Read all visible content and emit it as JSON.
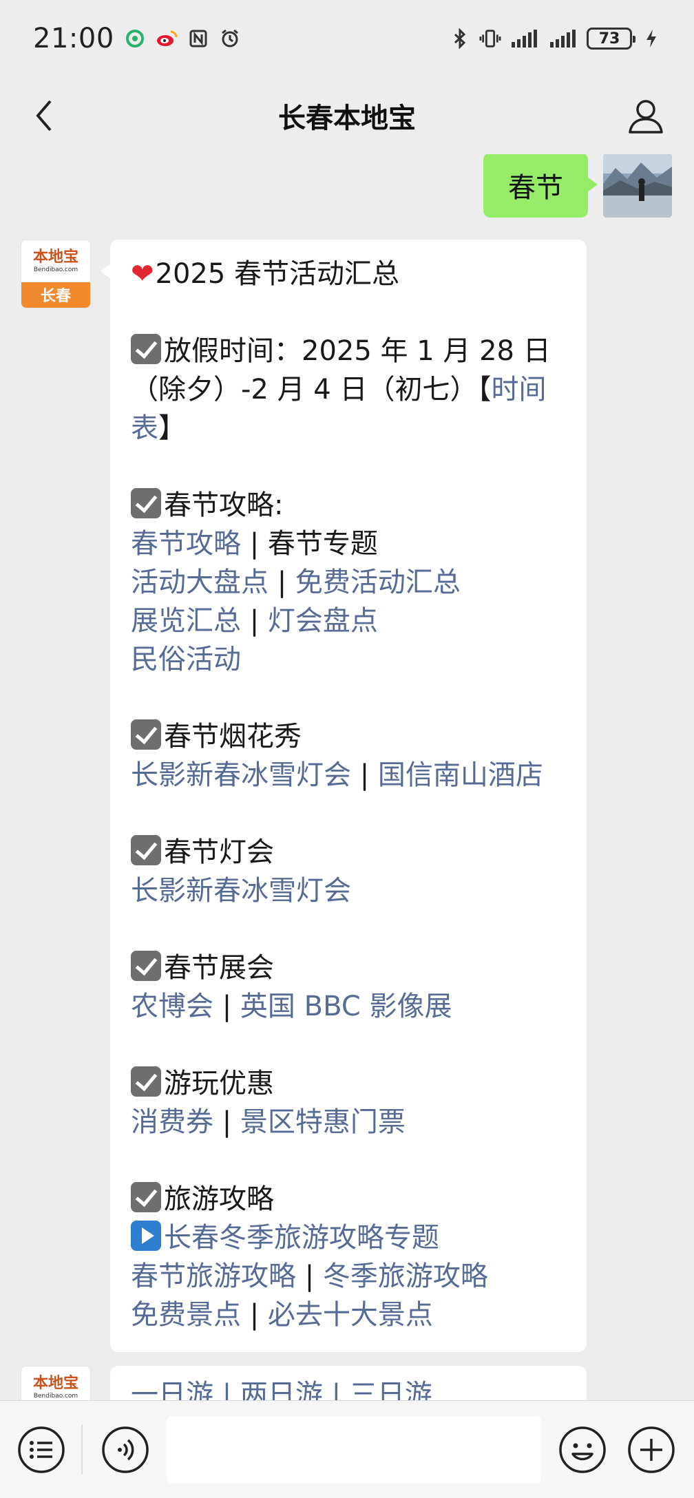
{
  "status_bar": {
    "time": "21:00",
    "battery": "73"
  },
  "nav": {
    "title": "长春本地宝"
  },
  "my_message": {
    "text": "春节"
  },
  "bot": {
    "avatar_brand": "本地宝",
    "avatar_sub": "Bendibao.com",
    "avatar_city": "长春"
  },
  "article": {
    "title": "2025 春节活动汇总",
    "holiday_label": "放假时间：2025 年 1 月 28 日",
    "holiday_line2": "（除夕）-2 月 4 日（初七）【",
    "holiday_link_a": "时间",
    "holiday_link_b": "表",
    "holiday_end": "】",
    "sections": {
      "guide_heading": "春节攻略:",
      "guide_links": {
        "l1": "春节攻略",
        "l2": "春节专题",
        "l3": "活动大盘点",
        "l4": "免费活动汇总",
        "l5": "展览汇总",
        "l6": "灯会盘点",
        "l7": "民俗活动"
      },
      "fireworks_heading": "春节烟花秀",
      "fireworks_links": {
        "l1": "长影新春冰雪灯会",
        "l2": "国信南山酒店"
      },
      "lantern_heading": "春节灯会",
      "lantern_links": {
        "l1": "长影新春冰雪灯会"
      },
      "expo_heading": "春节展会",
      "expo_links": {
        "l1": "农博会",
        "l2": "英国 BBC 影像展"
      },
      "deals_heading": "游玩优惠",
      "deals_links": {
        "l1": "消费券",
        "l2": "景区特惠门票"
      },
      "travel_heading": "旅游攻略",
      "travel_links": {
        "l1": "长春冬季旅游攻略专题",
        "l2": "春节旅游攻略",
        "l3": "冬季旅游攻略",
        "l4": "免费景点",
        "l5": "必去十大景点"
      }
    },
    "separator": "|"
  },
  "next_message": {
    "partial_text": "一日游 | 两日游 | 三日游"
  }
}
